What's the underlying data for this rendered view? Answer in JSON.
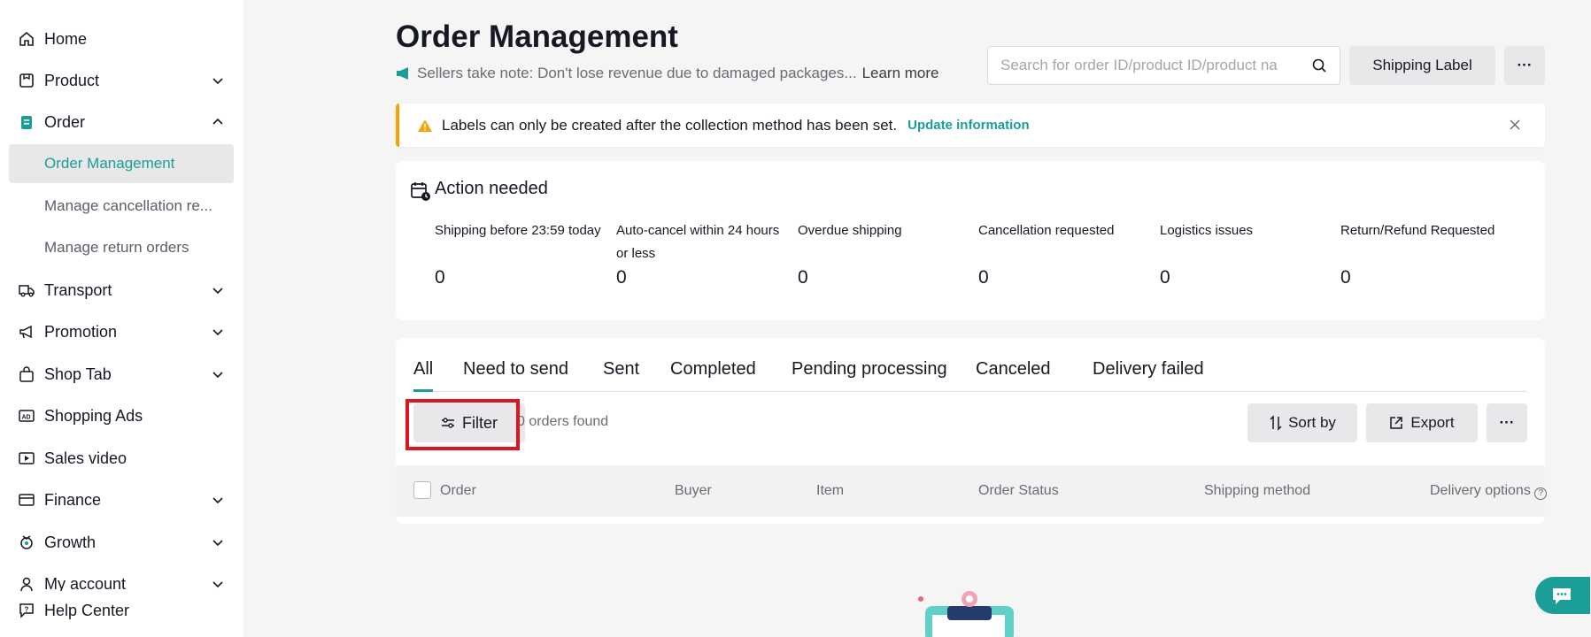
{
  "sidebar": {
    "items": [
      {
        "label": "Home",
        "icon": "home-icon"
      },
      {
        "label": "Product",
        "icon": "product-icon"
      },
      {
        "label": "Order",
        "icon": "order-icon"
      },
      {
        "label": "Transport",
        "icon": "truck-icon"
      },
      {
        "label": "Promotion",
        "icon": "megaphone-icon"
      },
      {
        "label": "Shop Tab",
        "icon": "shop-bag-icon"
      },
      {
        "label": "Shopping Ads",
        "icon": "ad-icon"
      },
      {
        "label": "Sales video",
        "icon": "video-icon"
      },
      {
        "label": "Finance",
        "icon": "wallet-icon"
      },
      {
        "label": "Growth",
        "icon": "growth-icon"
      },
      {
        "label": "My account",
        "icon": "user-icon"
      },
      {
        "label": "Help Center",
        "icon": "help-icon"
      }
    ],
    "order_sub": [
      {
        "label": "Order Management"
      },
      {
        "label": "Manage cancellation re..."
      },
      {
        "label": "Manage return orders"
      }
    ]
  },
  "header": {
    "title": "Order Management",
    "notice": "Sellers take note: Don't lose revenue due to damaged packages...",
    "learn_more": "Learn more",
    "search_placeholder": "Search for order ID/product ID/product na",
    "shipping_label": "Shipping Label",
    "more": "···"
  },
  "alert": {
    "text": "Labels can only be created after the collection method has been set.",
    "link": "Update information"
  },
  "action": {
    "title": "Action needed",
    "metrics": [
      {
        "label": "Shipping before 23:59 today",
        "value": "0"
      },
      {
        "label": "Auto-cancel within 24 hours or less",
        "value": "0"
      },
      {
        "label": "Overdue shipping",
        "value": "0"
      },
      {
        "label": "Cancellation requested",
        "value": "0"
      },
      {
        "label": "Logistics issues",
        "value": "0"
      },
      {
        "label": "Return/Refund Requested",
        "value": "0"
      }
    ]
  },
  "orders": {
    "tabs": [
      "All",
      "Need to send",
      "Sent",
      "Completed",
      "Pending processing",
      "Canceled",
      "Delivery failed"
    ],
    "filter": "Filter",
    "found": "0 orders found",
    "sort": "Sort by",
    "export": "Export",
    "more": "···",
    "columns": [
      "Order",
      "Buyer",
      "Item",
      "Order Status",
      "Shipping method",
      "Delivery options"
    ]
  },
  "colors": {
    "accent": "#1a9e97",
    "warning": "#f4a300",
    "highlight": "#e0141e"
  }
}
